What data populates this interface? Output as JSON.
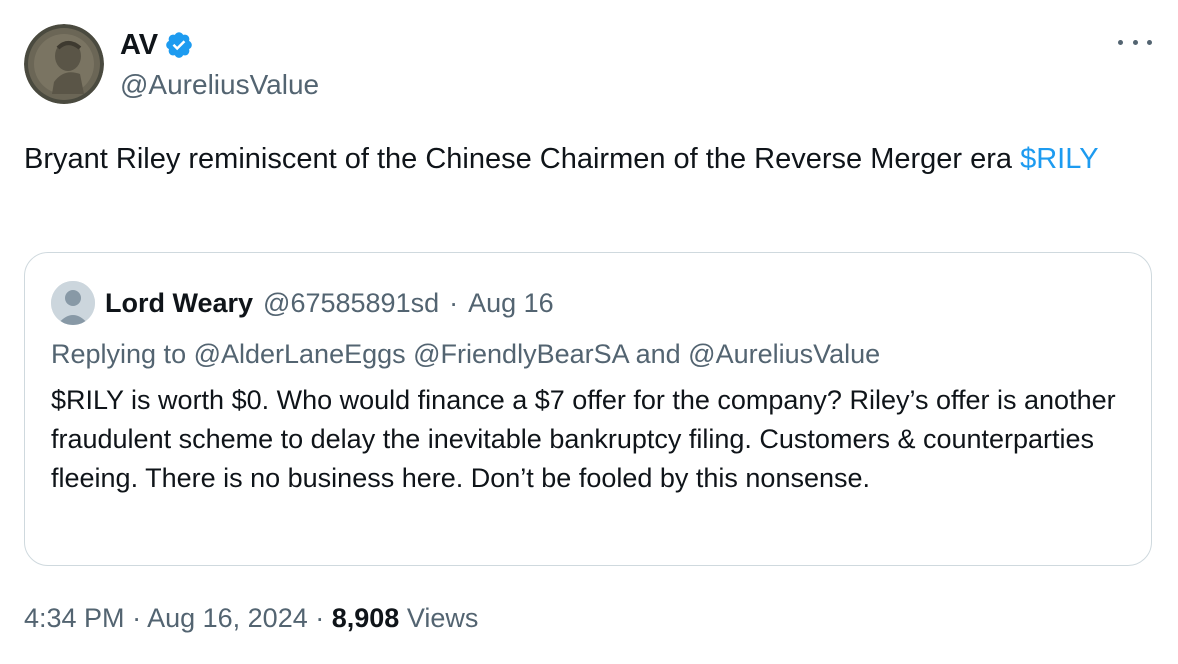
{
  "author": {
    "display_name": "AV",
    "handle": "@AureliusValue",
    "verified_icon": "verified-badge-icon",
    "badge_color": "#1d9bf0"
  },
  "more_icon": "more-horizontal-icon",
  "tweet": {
    "text_main": "Bryant Riley reminiscent of the Chinese Chairmen of the Reverse Merger era ",
    "cashtag": "$RILY",
    "cashtag_color": "#1d9bf0"
  },
  "quote": {
    "name": "Lord Weary",
    "handle": "@67585891sd",
    "separator": "·",
    "date": "Aug 16",
    "replying": "Replying to @AlderLaneEggs @FriendlyBearSA and @AureliusValue",
    "text": "$RILY is worth $0. Who would finance a $7 offer for the company? Riley’s offer is another fraudulent scheme to delay the inevitable bankruptcy filing. Customers & counterparties fleeing. There is no business here. Don’t be fooled by this nonsense."
  },
  "meta": {
    "time": "4:34 PM",
    "sep1": " · ",
    "date": "Aug 16, 2024",
    "sep2": " · ",
    "views_count": "8,908",
    "views_label": " Views"
  }
}
